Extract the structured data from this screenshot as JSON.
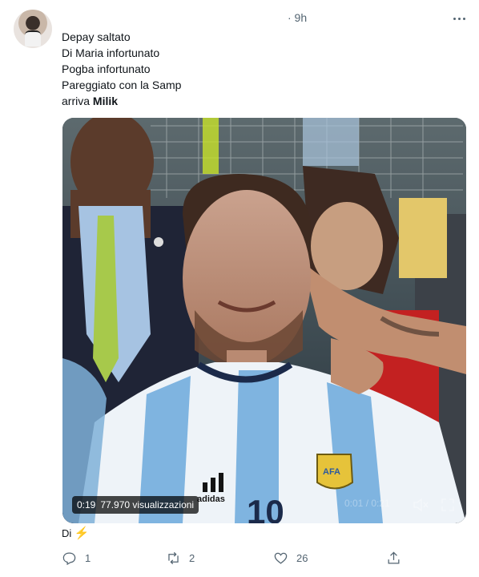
{
  "tweet": {
    "time": "· 9h",
    "lines": [
      "Depay saltato",
      "Di Maria infortunato",
      "Pogba infortunato",
      "Pareggiato con la Samp"
    ],
    "last_line_prefix": "arriva ",
    "last_line_bold": "Milik"
  },
  "media": {
    "elapsed": "0:19",
    "views": "77.970 visualizzazioni",
    "player_time": "0:01 / 0:21",
    "jersey_number": "10",
    "brand_text": "adidas",
    "crest_text": "AFA"
  },
  "caption": {
    "text": "Di",
    "emoji": "⚡"
  },
  "actions": {
    "reply_count": "1",
    "retweet_count": "2",
    "like_count": "26"
  },
  "colors": {
    "text_primary": "#0f1419",
    "text_secondary": "#536471",
    "argentina_blue": "#7fb4e0",
    "tie_green": "#a7c94b"
  },
  "icons": {
    "more": "more-horizontal-icon",
    "reply": "reply-icon",
    "retweet": "retweet-icon",
    "like": "heart-icon",
    "share": "share-icon",
    "mute": "volume-muted-icon",
    "fullscreen": "fullscreen-icon"
  }
}
